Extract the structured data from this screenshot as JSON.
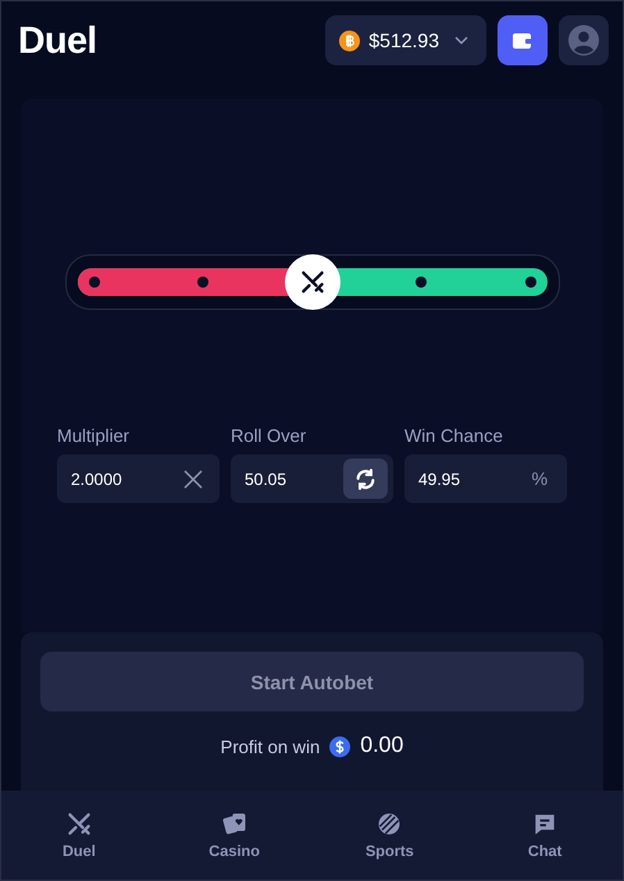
{
  "header": {
    "logo": "Duel",
    "balance": "$512.93"
  },
  "slider": {
    "level": 0.5
  },
  "fields": [
    {
      "label": "Multiplier",
      "value": "2.0000",
      "kind": "clear"
    },
    {
      "label": "Roll Over",
      "value": "50.05",
      "kind": "swap"
    },
    {
      "label": "Win Chance",
      "value": "49.95",
      "kind": "percent",
      "suffix": "%"
    }
  ],
  "start_button": "Start Autobet",
  "profit": {
    "label": "Profit on win",
    "amount": "0.00"
  },
  "nav": [
    {
      "label": "Duel",
      "kind": "duel"
    },
    {
      "label": "Casino",
      "kind": "casino"
    },
    {
      "label": "Sports",
      "kind": "sports"
    },
    {
      "label": "Chat",
      "kind": "chat"
    }
  ]
}
